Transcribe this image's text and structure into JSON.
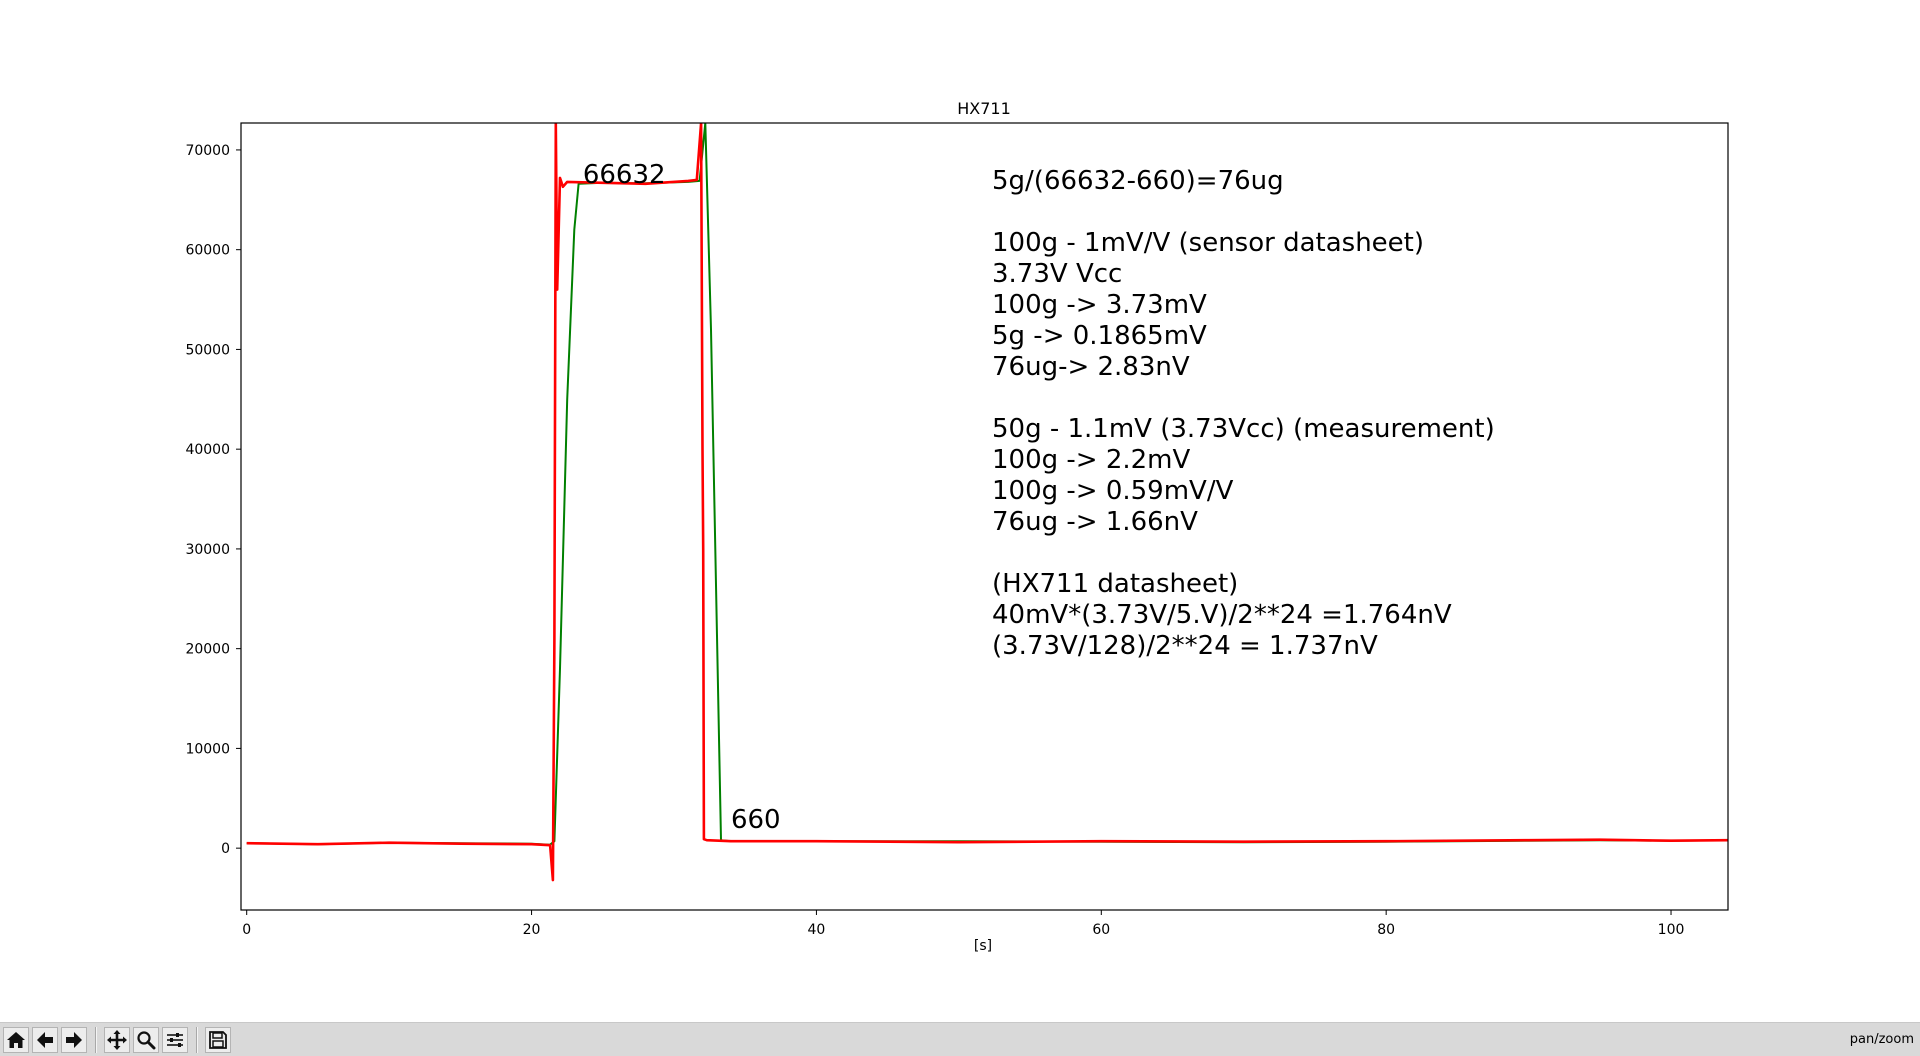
{
  "chart_data": {
    "type": "line",
    "title": "HX711",
    "xlabel": "[s]",
    "ylabel": "",
    "xlim": [
      -0.4,
      104
    ],
    "ylim": [
      -6200,
      72700
    ],
    "grid": false,
    "x_ticks": [
      0,
      20,
      40,
      60,
      80,
      100
    ],
    "y_ticks": [
      0,
      10000,
      20000,
      30000,
      40000,
      50000,
      60000,
      70000
    ],
    "series": [
      {
        "color": "#008000",
        "x": [
          0,
          5,
          10,
          15,
          20,
          21.3,
          21.6,
          22.0,
          22.5,
          23.0,
          23.3,
          25,
          28,
          31,
          31.8,
          32.2,
          32.6,
          33.3,
          34,
          40,
          50,
          60,
          70,
          80,
          90,
          95,
          100,
          104
        ],
        "y": [
          500,
          400,
          550,
          500,
          450,
          350,
          700,
          18000,
          45000,
          62000,
          66600,
          66700,
          66650,
          66800,
          66900,
          72700,
          52000,
          800,
          700,
          700,
          700,
          650,
          600,
          650,
          750,
          800,
          750,
          800
        ]
      },
      {
        "color": "#ff0000",
        "x": [
          0,
          5,
          10,
          15,
          20,
          21.3,
          21.5,
          21.6,
          21.7,
          21.8,
          22.0,
          22.2,
          22.5,
          25,
          28,
          31,
          31.6,
          31.9,
          32.0,
          32.05,
          32.1,
          32.3,
          34,
          40,
          50,
          60,
          70,
          80,
          90,
          95,
          100,
          104
        ],
        "y": [
          500,
          400,
          550,
          450,
          400,
          300,
          -3200,
          21000,
          72700,
          56000,
          67200,
          66300,
          66800,
          66700,
          66600,
          66900,
          67000,
          72700,
          40000,
          30000,
          900,
          800,
          700,
          700,
          600,
          700,
          650,
          700,
          800,
          850,
          750,
          800
        ]
      }
    ],
    "annotations": [
      {
        "text": "66632",
        "x": 23.6,
        "y": 66700
      },
      {
        "text": "660",
        "x": 34.0,
        "y": 2000
      }
    ],
    "notes": [
      "5g/(66632-660)=76ug",
      "",
      "100g - 1mV/V (sensor datasheet)",
      "3.73V Vcc",
      "100g -> 3.73mV",
      "5g -> 0.1865mV",
      "76ug-> 2.83nV",
      "",
      "50g - 1.1mV (3.73Vcc) (measurement)",
      "100g -> 2.2mV",
      "100g -> 0.59mV/V",
      "76ug -> 1.66nV",
      "",
      "(HX711 datasheet)",
      "40mV*(3.73V/5.V)/2**24 =1.764nV",
      "(3.73V/128)/2**24 = 1.737nV"
    ]
  },
  "toolbar": {
    "buttons": [
      {
        "icon": "home-icon"
      },
      {
        "icon": "back-arrow-icon"
      },
      {
        "icon": "forward-arrow-icon"
      },
      {
        "icon": "pan-icon"
      },
      {
        "icon": "zoom-icon"
      },
      {
        "icon": "configure-subplots-icon"
      },
      {
        "icon": "save-icon"
      }
    ],
    "status": "pan/zoom"
  }
}
